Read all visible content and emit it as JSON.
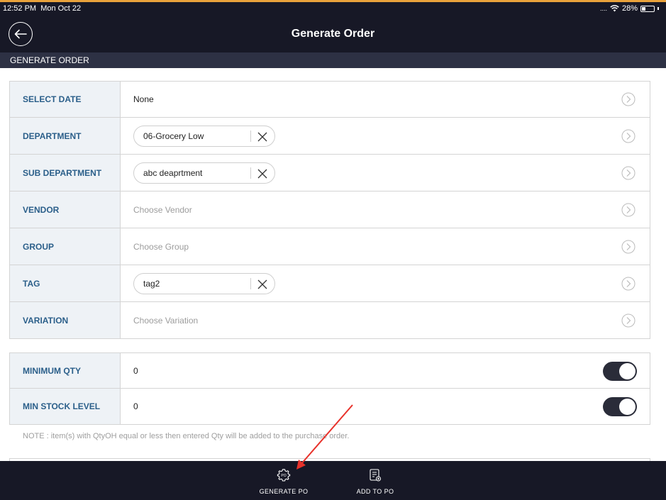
{
  "status_bar": {
    "time": "12:52 PM",
    "date": "Mon Oct 22",
    "signal": "....",
    "battery": "28%"
  },
  "nav": {
    "title": "Generate Order"
  },
  "section_header": "GENERATE ORDER",
  "filters": [
    {
      "label": "SELECT DATE",
      "value": "None"
    },
    {
      "label": "DEPARTMENT",
      "chip": "06-Grocery Low"
    },
    {
      "label": "SUB DEPARTMENT",
      "chip": "abc deaprtment"
    },
    {
      "label": "VENDOR",
      "placeholder": "Choose Vendor"
    },
    {
      "label": "GROUP",
      "placeholder": "Choose Group"
    },
    {
      "label": "TAG",
      "chip": "tag2"
    },
    {
      "label": "VARIATION",
      "placeholder": "Choose Variation"
    }
  ],
  "qty_rows": [
    {
      "label": "MINIMUM QTY",
      "value": "0",
      "toggle_on": true
    },
    {
      "label": "MIN STOCK LEVEL",
      "value": "0",
      "toggle_on": true
    }
  ],
  "note": "NOTE : item(s) with QtyOH equal or less then entered Qty will be added to the purchase order.",
  "bottom_actions": {
    "generate_po": "GENERATE PO",
    "add_to_po": "ADD TO PO"
  },
  "colors": {
    "nav_bg": "#171826",
    "section_bg": "#2d3144",
    "label_text": "#2b5f8a",
    "label_bg": "#eef2f6",
    "annotation_arrow": "#e8322b"
  }
}
